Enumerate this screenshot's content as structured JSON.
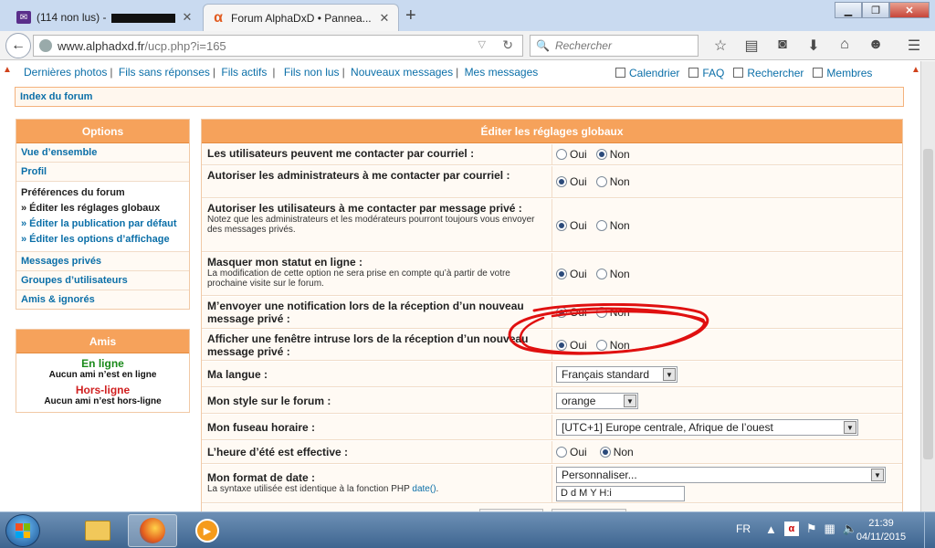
{
  "browser": {
    "tabs": [
      {
        "label": "(114 non lus) - ",
        "icon": "mail-icon",
        "redacted": true
      },
      {
        "label": "Forum AlphaDxD • Pannea...",
        "icon": "alphadxd-icon"
      }
    ],
    "url_host": "www.alphadxd.fr",
    "url_path": "/ucp.php?i=165",
    "search_placeholder": "Rechercher"
  },
  "top_links": {
    "left": [
      "Dernières photos",
      "Fils sans réponses",
      "Fils actifs",
      "Fils non lus",
      "Nouveaux messages",
      "Mes messages"
    ],
    "right": [
      "Calendrier",
      "FAQ",
      "Rechercher",
      "Membres"
    ]
  },
  "breadcrumb": "Index du forum",
  "sidebar": {
    "options_title": "Options",
    "items": [
      "Vue d’ensemble",
      "Profil"
    ],
    "prefs_title": "Préférences du forum",
    "prefs": [
      {
        "label": "» Éditer les réglages globaux",
        "current": true
      },
      {
        "label": "» Éditer la publication par défaut",
        "current": false
      },
      {
        "label": "» Éditer les options d’affichage",
        "current": false
      }
    ],
    "items2": [
      "Messages privés",
      "Groupes d’utilisateurs",
      "Amis & ignorés"
    ],
    "friends_title": "Amis",
    "online_title": "En ligne",
    "online_note": "Aucun ami n’est en ligne",
    "offline_title": "Hors-ligne",
    "offline_note": "Aucun ami n’est hors-ligne"
  },
  "panel": {
    "title": "Éditer les réglages globaux",
    "yes": "Oui",
    "no": "Non",
    "rows": [
      {
        "label": "Les utilisateurs peuvent me contacter par courriel :",
        "explain": "",
        "value": "no"
      },
      {
        "label": "Autoriser les administrateurs à me contacter par courriel :",
        "explain": "",
        "value": "yes"
      },
      {
        "label": "Autoriser les utilisateurs à me contacter par message privé :",
        "explain": "Notez que les administrateurs et les modérateurs pourront toujours vous envoyer des messages privés.",
        "value": "yes"
      },
      {
        "label": "Masquer mon statut en ligne :",
        "explain": "La modification de cette option ne sera prise en compte qu’à partir de votre prochaine visite sur le forum.",
        "value": "yes"
      },
      {
        "label": "M’envoyer une notification lors de la réception d’un nouveau message privé :",
        "explain": "",
        "value": "yes"
      },
      {
        "label": "Afficher une fenêtre intruse lors de la réception d’un nouveau message privé :",
        "explain": "",
        "value": "yes"
      }
    ],
    "language_label": "Ma langue :",
    "language_value": "Français standard",
    "style_label": "Mon style sur le forum :",
    "style_value": "orange",
    "timezone_label": "Mon fuseau horaire :",
    "timezone_value": "[UTC+1] Europe centrale, Afrique de l’ouest",
    "dst_label": "L’heure d’été est effective :",
    "dst_value": "no",
    "dateformat_label": "Mon format de date :",
    "dateformat_explain": "La syntaxe utilisée est identique à la fonction PHP ",
    "dateformat_link": "date()",
    "dateformat_explain_end": ".",
    "dateformat_select": "Personnaliser...",
    "dateformat_value": "D d M Y H:i"
  },
  "taskbar": {
    "lang": "FR",
    "time": "21:39",
    "date": "04/11/2015"
  },
  "annotation_color": "#e01010"
}
